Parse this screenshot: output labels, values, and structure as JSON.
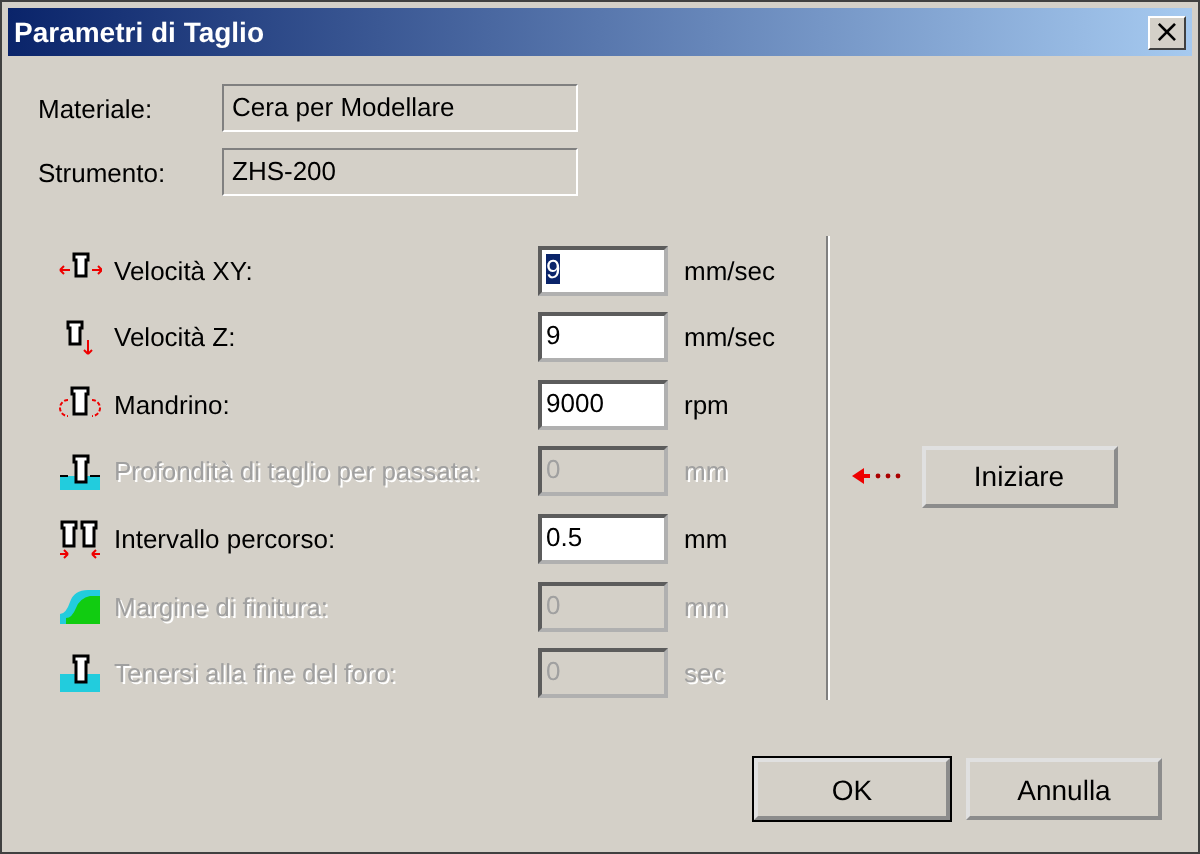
{
  "window": {
    "title": "Parametri di Taglio",
    "close_glyph": "×"
  },
  "info": [
    {
      "label": "Materiale:",
      "value": "Cera per Modellare"
    },
    {
      "label": "Strumento:",
      "value": "ZHS-200"
    }
  ],
  "params": [
    {
      "kind": "xy",
      "label": "Velocità XY:",
      "value": "9",
      "unit": "mm/sec",
      "disabled": false,
      "highlighted": true
    },
    {
      "kind": "z",
      "label": "Velocità Z:",
      "value": "9",
      "unit": "mm/sec",
      "disabled": false,
      "highlighted": false
    },
    {
      "kind": "spindle",
      "label": "Mandrino:",
      "value": "9000",
      "unit": "rpm",
      "disabled": false,
      "highlighted": false
    },
    {
      "kind": "depth",
      "label": "Profondità di taglio per passata:",
      "value": "0",
      "unit": "mm",
      "disabled": true,
      "highlighted": false
    },
    {
      "kind": "interval",
      "label": "Intervallo percorso:",
      "value": "0.5",
      "unit": "mm",
      "disabled": false,
      "highlighted": false
    },
    {
      "kind": "margin",
      "label": "Margine di finitura:",
      "value": "0",
      "unit": "mm",
      "disabled": true,
      "highlighted": false
    },
    {
      "kind": "dwell",
      "label": "Tenersi alla fine del foro:",
      "value": "0",
      "unit": "sec",
      "disabled": true,
      "highlighted": false
    }
  ],
  "start_button": "Iniziare",
  "buttons": [
    {
      "label": "OK",
      "default": true
    },
    {
      "label": "Annulla",
      "default": false
    }
  ]
}
